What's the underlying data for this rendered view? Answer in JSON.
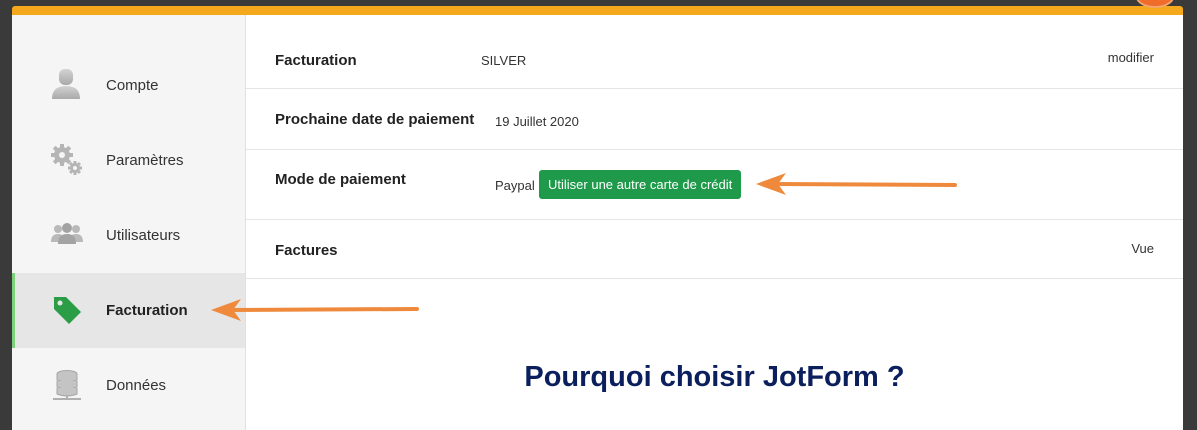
{
  "sidebar": {
    "items": [
      {
        "label": "Compte",
        "icon": "user-icon"
      },
      {
        "label": "Paramètres",
        "icon": "gears-icon"
      },
      {
        "label": "Utilisateurs",
        "icon": "users-icon"
      },
      {
        "label": "Facturation",
        "icon": "price-tag-icon",
        "active": true
      },
      {
        "label": "Données",
        "icon": "database-icon"
      }
    ]
  },
  "billing": {
    "plan_label": "Facturation",
    "plan_value": "SILVER",
    "plan_action": "modifier",
    "next_payment_label": "Prochaine date de paiement",
    "next_payment_value": "19 Juillet 2020",
    "payment_method_label": "Mode de paiement",
    "payment_method_value": "Paypal",
    "payment_method_button": "Utiliser une autre carte de crédit",
    "invoices_label": "Factures",
    "invoices_action": "Vue"
  },
  "promo": {
    "title": "Pourquoi choisir JotForm ?"
  },
  "colors": {
    "accent": "#f5a81c",
    "button": "#1e9a4a",
    "active_bar": "#7ed07a",
    "annotation_arrow": "#ef8a3c",
    "promo_title": "#0a1f5c"
  }
}
